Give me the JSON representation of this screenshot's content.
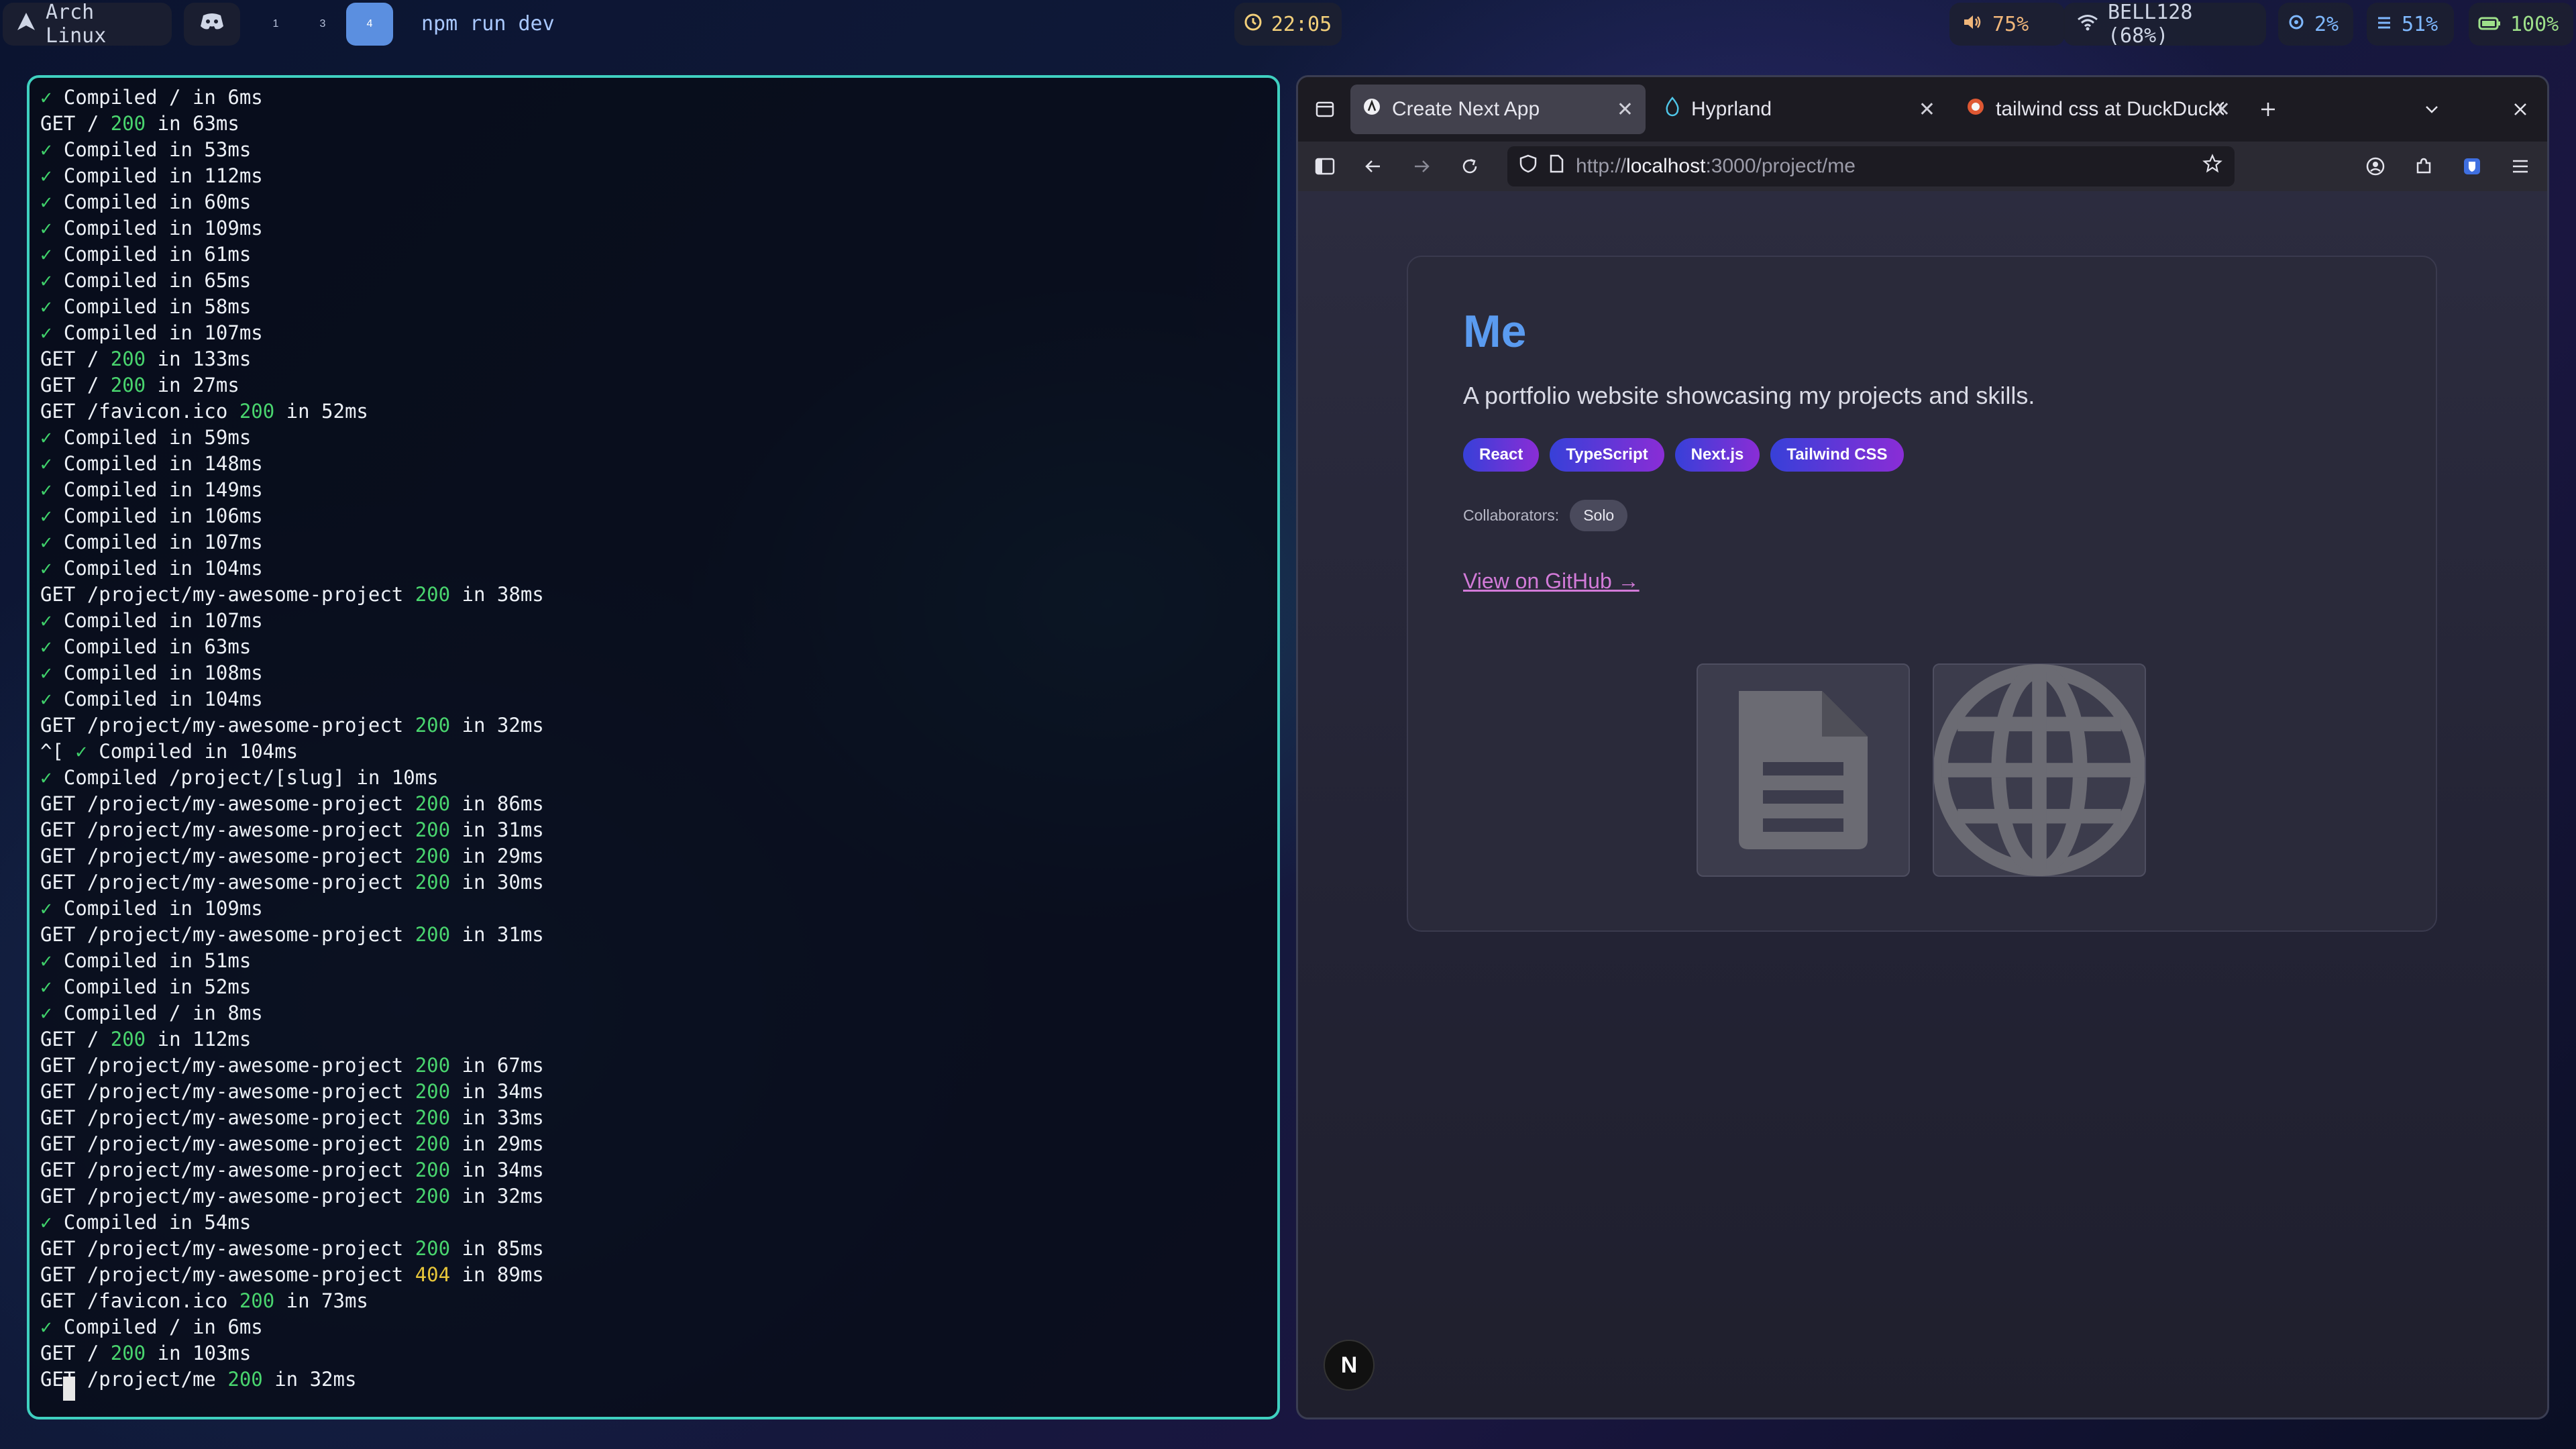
{
  "topbar": {
    "os_label": "Arch Linux",
    "workspaces": [
      "1",
      "3",
      "4"
    ],
    "active_workspace": "4",
    "window_title": "npm run dev",
    "clock": "22:05",
    "volume": "75%",
    "wifi": "BELL128 (68%)",
    "cpu": "2%",
    "memory": "51%",
    "battery": "100%"
  },
  "terminal": {
    "lines": [
      [
        [
          "c",
          "✓ "
        ],
        [
          "n",
          "Compiled / in 6ms"
        ]
      ],
      [
        [
          "n",
          "GET / "
        ],
        [
          "g",
          "200"
        ],
        [
          "n",
          " in 63ms"
        ]
      ],
      [
        [
          "c",
          "✓ "
        ],
        [
          "n",
          "Compiled in 53ms"
        ]
      ],
      [
        [
          "c",
          "✓ "
        ],
        [
          "n",
          "Compiled in 112ms"
        ]
      ],
      [
        [
          "c",
          "✓ "
        ],
        [
          "n",
          "Compiled in 60ms"
        ]
      ],
      [
        [
          "c",
          "✓ "
        ],
        [
          "n",
          "Compiled in 109ms"
        ]
      ],
      [
        [
          "c",
          "✓ "
        ],
        [
          "n",
          "Compiled in 61ms"
        ]
      ],
      [
        [
          "c",
          "✓ "
        ],
        [
          "n",
          "Compiled in 65ms"
        ]
      ],
      [
        [
          "c",
          "✓ "
        ],
        [
          "n",
          "Compiled in 58ms"
        ]
      ],
      [
        [
          "c",
          "✓ "
        ],
        [
          "n",
          "Compiled in 107ms"
        ]
      ],
      [
        [
          "n",
          "GET / "
        ],
        [
          "g",
          "200"
        ],
        [
          "n",
          " in 133ms"
        ]
      ],
      [
        [
          "n",
          "GET / "
        ],
        [
          "g",
          "200"
        ],
        [
          "n",
          " in 27ms"
        ]
      ],
      [
        [
          "n",
          "GET /favicon.ico "
        ],
        [
          "g",
          "200"
        ],
        [
          "n",
          " in 52ms"
        ]
      ],
      [
        [
          "c",
          "✓ "
        ],
        [
          "n",
          "Compiled in 59ms"
        ]
      ],
      [
        [
          "c",
          "✓ "
        ],
        [
          "n",
          "Compiled in 148ms"
        ]
      ],
      [
        [
          "c",
          "✓ "
        ],
        [
          "n",
          "Compiled in 149ms"
        ]
      ],
      [
        [
          "c",
          "✓ "
        ],
        [
          "n",
          "Compiled in 106ms"
        ]
      ],
      [
        [
          "c",
          "✓ "
        ],
        [
          "n",
          "Compiled in 107ms"
        ]
      ],
      [
        [
          "c",
          "✓ "
        ],
        [
          "n",
          "Compiled in 104ms"
        ]
      ],
      [
        [
          "n",
          "GET /project/my-awesome-project "
        ],
        [
          "g",
          "200"
        ],
        [
          "n",
          " in 38ms"
        ]
      ],
      [
        [
          "c",
          "✓ "
        ],
        [
          "n",
          "Compiled in 107ms"
        ]
      ],
      [
        [
          "c",
          "✓ "
        ],
        [
          "n",
          "Compiled in 63ms"
        ]
      ],
      [
        [
          "c",
          "✓ "
        ],
        [
          "n",
          "Compiled in 108ms"
        ]
      ],
      [
        [
          "c",
          "✓ "
        ],
        [
          "n",
          "Compiled in 104ms"
        ]
      ],
      [
        [
          "n",
          "GET /project/my-awesome-project "
        ],
        [
          "g",
          "200"
        ],
        [
          "n",
          " in 32ms"
        ]
      ],
      [
        [
          "x",
          "^[ "
        ],
        [
          "c",
          "✓ "
        ],
        [
          "n",
          "Compiled in 104ms"
        ]
      ],
      [
        [
          "c",
          "✓ "
        ],
        [
          "n",
          "Compiled /project/[slug] in 10ms"
        ]
      ],
      [
        [
          "n",
          "GET /project/my-awesome-project "
        ],
        [
          "g",
          "200"
        ],
        [
          "n",
          " in 86ms"
        ]
      ],
      [
        [
          "n",
          "GET /project/my-awesome-project "
        ],
        [
          "g",
          "200"
        ],
        [
          "n",
          " in 31ms"
        ]
      ],
      [
        [
          "n",
          "GET /project/my-awesome-project "
        ],
        [
          "g",
          "200"
        ],
        [
          "n",
          " in 29ms"
        ]
      ],
      [
        [
          "n",
          "GET /project/my-awesome-project "
        ],
        [
          "g",
          "200"
        ],
        [
          "n",
          " in 30ms"
        ]
      ],
      [
        [
          "c",
          "✓ "
        ],
        [
          "n",
          "Compiled in 109ms"
        ]
      ],
      [
        [
          "n",
          "GET /project/my-awesome-project "
        ],
        [
          "g",
          "200"
        ],
        [
          "n",
          " in 31ms"
        ]
      ],
      [
        [
          "c",
          "✓ "
        ],
        [
          "n",
          "Compiled in 51ms"
        ]
      ],
      [
        [
          "c",
          "✓ "
        ],
        [
          "n",
          "Compiled in 52ms"
        ]
      ],
      [
        [
          "c",
          "✓ "
        ],
        [
          "n",
          "Compiled / in 8ms"
        ]
      ],
      [
        [
          "n",
          "GET / "
        ],
        [
          "g",
          "200"
        ],
        [
          "n",
          " in 112ms"
        ]
      ],
      [
        [
          "n",
          "GET /project/my-awesome-project "
        ],
        [
          "g",
          "200"
        ],
        [
          "n",
          " in 67ms"
        ]
      ],
      [
        [
          "n",
          "GET /project/my-awesome-project "
        ],
        [
          "g",
          "200"
        ],
        [
          "n",
          " in 34ms"
        ]
      ],
      [
        [
          "n",
          "GET /project/my-awesome-project "
        ],
        [
          "g",
          "200"
        ],
        [
          "n",
          " in 33ms"
        ]
      ],
      [
        [
          "n",
          "GET /project/my-awesome-project "
        ],
        [
          "g",
          "200"
        ],
        [
          "n",
          " in 29ms"
        ]
      ],
      [
        [
          "n",
          "GET /project/my-awesome-project "
        ],
        [
          "g",
          "200"
        ],
        [
          "n",
          " in 34ms"
        ]
      ],
      [
        [
          "n",
          "GET /project/my-awesome-project "
        ],
        [
          "g",
          "200"
        ],
        [
          "n",
          " in 32ms"
        ]
      ],
      [
        [
          "c",
          "✓ "
        ],
        [
          "n",
          "Compiled in 54ms"
        ]
      ],
      [
        [
          "n",
          "GET /project/my-awesome-project "
        ],
        [
          "g",
          "200"
        ],
        [
          "n",
          " in 85ms"
        ]
      ],
      [
        [
          "n",
          "GET /project/my-awesome-project "
        ],
        [
          "y",
          "404"
        ],
        [
          "n",
          " in 89ms"
        ]
      ],
      [
        [
          "n",
          "GET /favicon.ico "
        ],
        [
          "g",
          "200"
        ],
        [
          "n",
          " in 73ms"
        ]
      ],
      [
        [
          "c",
          "✓ "
        ],
        [
          "n",
          "Compiled / in 6ms"
        ]
      ],
      [
        [
          "n",
          "GET / "
        ],
        [
          "g",
          "200"
        ],
        [
          "n",
          " in 103ms"
        ]
      ],
      [
        [
          "n",
          "GET /project/me "
        ],
        [
          "g",
          "200"
        ],
        [
          "n",
          " in 32ms"
        ]
      ]
    ]
  },
  "browser": {
    "tabs": [
      {
        "label": "Create Next App",
        "icon": "nextjs-icon",
        "active": true
      },
      {
        "label": "Hyprland",
        "icon": "hyprland-icon",
        "active": false
      },
      {
        "label": "tailwind css at DuckDuckGo",
        "icon": "duckduckgo-icon",
        "active": false
      }
    ],
    "url_prefix": "http://",
    "url_host": "localhost",
    "url_path": ":3000/project/me"
  },
  "page": {
    "title": "Me",
    "description": "A portfolio website showcasing my projects and skills.",
    "tags": [
      "React",
      "TypeScript",
      "Next.js",
      "Tailwind CSS"
    ],
    "collaborators_label": "Collaborators:",
    "collaborators": [
      "Solo"
    ],
    "github_link": "View on GitHub →",
    "thumbnails": [
      "document-icon",
      "globe-icon"
    ],
    "next_badge": "N"
  },
  "colors": {
    "accent": "#5b8fe0",
    "terminal_border": "#3fd0c0",
    "status_ok": "#49d46e",
    "status_404": "#e6c53a",
    "title": "#5a9bf0",
    "link": "#d27ad8"
  }
}
